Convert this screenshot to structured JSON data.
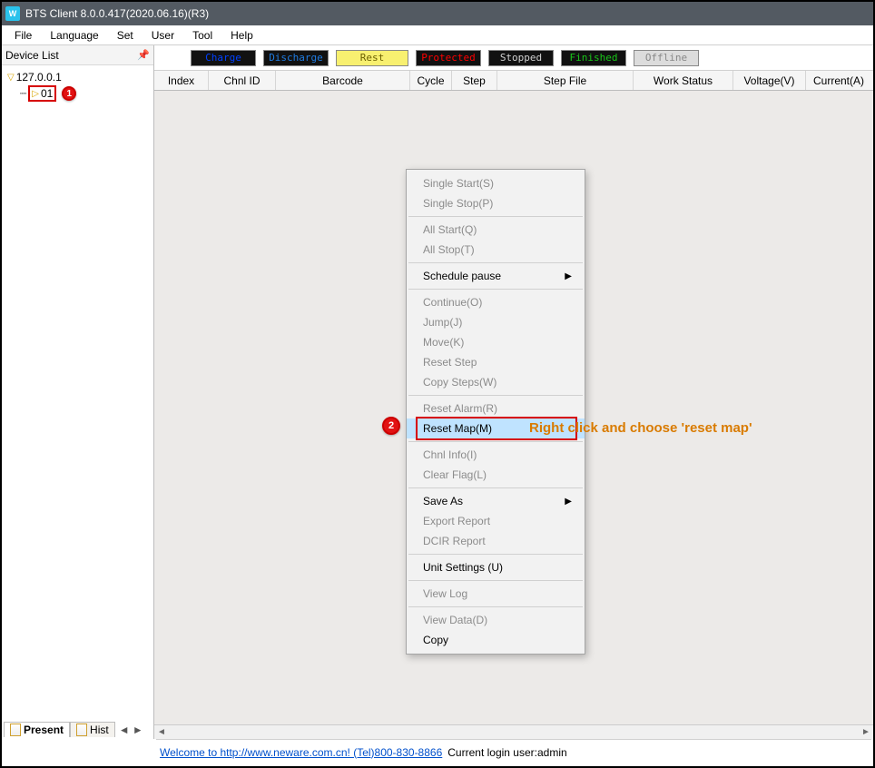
{
  "titlebar": {
    "text": "BTS Client 8.0.0.417(2020.06.16)(R3)"
  },
  "menubar": [
    "File",
    "Language",
    "Set",
    "User",
    "Tool",
    "Help"
  ],
  "sidebar": {
    "title": "Device List",
    "ip": "127.0.0.1",
    "device": "01"
  },
  "status_pills": {
    "charge": "Charge",
    "discharge": "Discharge",
    "rest": "Rest",
    "protected": "Protected",
    "stopped": "Stopped",
    "finished": "Finished",
    "offline": "Offline"
  },
  "table_headers": {
    "index": "Index",
    "chnl": "Chnl ID",
    "barcode": "Barcode",
    "cycle": "Cycle",
    "step": "Step",
    "stepfile": "Step File",
    "work": "Work Status",
    "volt": "Voltage(V)",
    "curr": "Current(A)"
  },
  "ctx": {
    "single_start": "Single Start(S)",
    "single_stop": "Single Stop(P)",
    "all_start": "All Start(Q)",
    "all_stop": "All Stop(T)",
    "schedule_pause": "Schedule pause",
    "continue": "Continue(O)",
    "jump": "Jump(J)",
    "move": "Move(K)",
    "reset_step": "Reset Step",
    "copy_steps": "Copy Steps(W)",
    "reset_alarm": "Reset Alarm(R)",
    "reset_map": "Reset Map(M)",
    "chnl_info": "Chnl Info(I)",
    "clear_flag": "Clear Flag(L)",
    "save_as": "Save As",
    "export_report": "Export Report",
    "dcir_report": "DCIR Report",
    "unit_settings": "Unit Settings (U)",
    "view_log": "View Log",
    "view_data": "View Data(D)",
    "copy": "Copy"
  },
  "annotation": "Right click and choose 'reset map'",
  "badges": {
    "one": "1",
    "two": "2"
  },
  "tabs": {
    "present": "Present",
    "hist": "Hist"
  },
  "footer": {
    "link": "Welcome to http://www.neware.com.cn! (Tel)800-830-8866",
    "login": "Current login user:admin"
  }
}
